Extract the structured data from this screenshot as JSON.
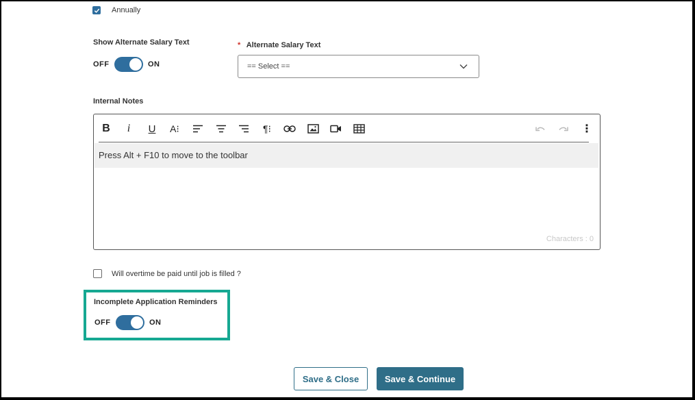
{
  "annually": {
    "label": "Annually",
    "checked": true
  },
  "alt_salary_toggle": {
    "title": "Show Alternate Salary Text",
    "off": "OFF",
    "on": "ON",
    "state": "on"
  },
  "alt_salary_select": {
    "required_mark": "*",
    "label": "Alternate Salary Text",
    "value": "== Select =="
  },
  "internal_notes": {
    "label": "Internal Notes",
    "toolbar": {
      "bold": "B",
      "italic": "i",
      "underline": "U",
      "font_size": "A⁝",
      "paragraph": "¶⁝",
      "more": "⋮"
    },
    "placeholder": "Press Alt + F10 to move to the toolbar",
    "char_count": "Characters : 0"
  },
  "overtime": {
    "label": "Will overtime be paid until job is filled ?",
    "checked": false
  },
  "reminders": {
    "title": "Incomplete Application Reminders",
    "off": "OFF",
    "on": "ON",
    "state": "on"
  },
  "buttons": {
    "save_close": "Save & Close",
    "save_continue": "Save & Continue"
  },
  "colors": {
    "accent": "#2f6e9e",
    "highlight": "#16a892",
    "button": "#2f6e88"
  }
}
